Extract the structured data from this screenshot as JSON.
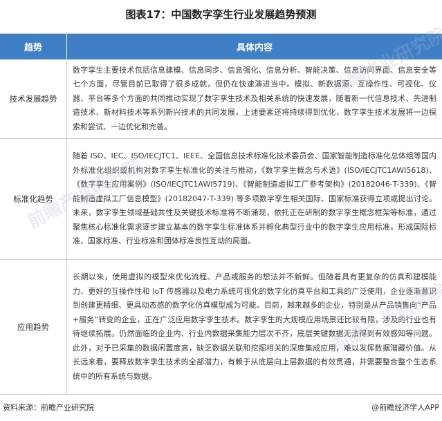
{
  "title": "图表17：中国数字孪生行业发展趋势预测",
  "table": {
    "headers": [
      "趋势",
      "具体内容"
    ],
    "rows": [
      {
        "trend": "技术发展趋势",
        "content": "数字孪生主要技术包括信息建模、信息同步、信息强化、信息分析、智能决策、信息访问界面、信息安全等七个方面，尽管目前已取得了很多成就，但仍在快速演进当中。模拟、新数据源、互操作性、可视化、仪器、平台等多个方面的共同推动实现了数字孪生技术及相关系统的快速发展，随着新一代信息技术、先进制造技术、新材料技术等系列新兴技术的共同发展，上述要素还将持续得到优化，数字孪生技术发展将一边探索和尝试、一边优化和完善。"
      },
      {
        "trend": "标准化趋势",
        "content": "随着 ISO、IEC、ISO/IECJTC1、IEEE、全国信息技术标准化技术委员会、国家智能制造标准化总体组等国内外标准化组织或机构对数字孪生标准化的关注与推动，《数字孪生概念与术语》(ISO/IECJTC1AWI5618)、《数字孪生应用案例》(ISO/IECJTC1AWI5719)、《智能制造虚拟工厂参考架构》(20182046-T-339)、《智能制造虚拟工厂信息模型》(20182047-T-339) 等多项数字孪生相关国际、国家标准获得立项或提出讨论。未来，数字孪生领域基础共性及关键技术标准将不断涌现，依托正在研制的数字孪生概念框架等标准，通过聚焦核心标准化需求逐步建立基本的数字孪生标准体系并孵化典型行业中的数字孪生应用标准，形成国际标准、国家标准、行业标准和团体标准良性互动的局面。"
      },
      {
        "trend": "应用趋势",
        "content": "长期以来，使用虚拟的模型来优化流程、产品或服务的想法并不新鲜。但随着具有更复杂的仿真和建模能力、更好的互操作性和 IoT 传感器以及电力系统可视化的数字化仿真平台和工具的广泛使用，企业逐渐意识到创建更精细、更具动态感的数字化仿真模型成为可能。目前，越来越多的企业，特别是从产品销售向“产品+服务”转变的企业，正在广泛应用数字孪生技术。数字孪生的大规模应用场景还比较有限，涉及的行业也有待继续拓展。仍然面临的企业内、行业内数据采集能力层次不齐，底层关键数据无法得到有效感知等问题。此外，对于已采集的数据闲置度高，缺乏数据关联和挖掘相关的深度集成应用，难以发挥数据潜藏价值。从长远来看，要释放数字孪生技术的全部潜力，有赖于从底层向上层数据的有效贯通，并需要整合整个生态系统中的所有系统与数据。"
      }
    ]
  },
  "footer": {
    "source": "资料来源：前瞻产业研究院",
    "credit": "@前瞻经济学人APP"
  },
  "watermarks": [
    "前瞻产业研究院",
    "前瞻产业研究院",
    "前瞻产业研究院"
  ]
}
